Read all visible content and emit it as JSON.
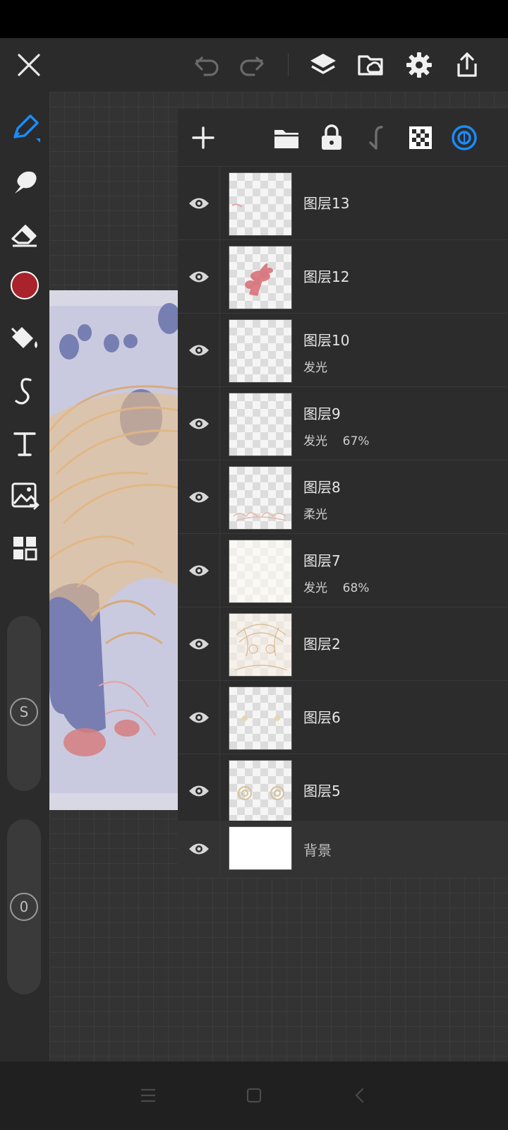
{
  "icons": {
    "close": "close-icon",
    "undo": "undo-icon",
    "redo": "redo-icon",
    "layers": "layers-icon",
    "gallery": "cloud-folder-icon",
    "settings": "gear-icon",
    "share": "share-icon"
  },
  "colors": {
    "accent": "#1a8cff",
    "current_color": "#a8232b",
    "panel_bg": "#2c2c2c",
    "toolbar_bg": "#2b2b2b"
  },
  "tools": [
    "pen-tool",
    "smudge-tool",
    "eraser-tool",
    "color-picker",
    "fill-tool",
    "curve-tool",
    "text-tool",
    "image-tool",
    "filter-tool"
  ],
  "sliders": {
    "size_label": "S",
    "opacity_label": "0"
  },
  "layers": [
    {
      "name": "图层13",
      "blend": "",
      "opacity": ""
    },
    {
      "name": "图层12",
      "blend": "",
      "opacity": ""
    },
    {
      "name": "图层10",
      "blend": "发光",
      "opacity": ""
    },
    {
      "name": "图层9",
      "blend": "发光",
      "opacity": "67%"
    },
    {
      "name": "图层8",
      "blend": "柔光",
      "opacity": ""
    },
    {
      "name": "图层7",
      "blend": "发光",
      "opacity": "68%"
    },
    {
      "name": "图层2",
      "blend": "",
      "opacity": ""
    },
    {
      "name": "图层6",
      "blend": "",
      "opacity": ""
    },
    {
      "name": "图层5",
      "blend": "",
      "opacity": ""
    }
  ],
  "background_layer": {
    "name": "背景"
  },
  "nav": [
    "menu-nav-icon",
    "home-nav-icon",
    "back-nav-icon"
  ]
}
